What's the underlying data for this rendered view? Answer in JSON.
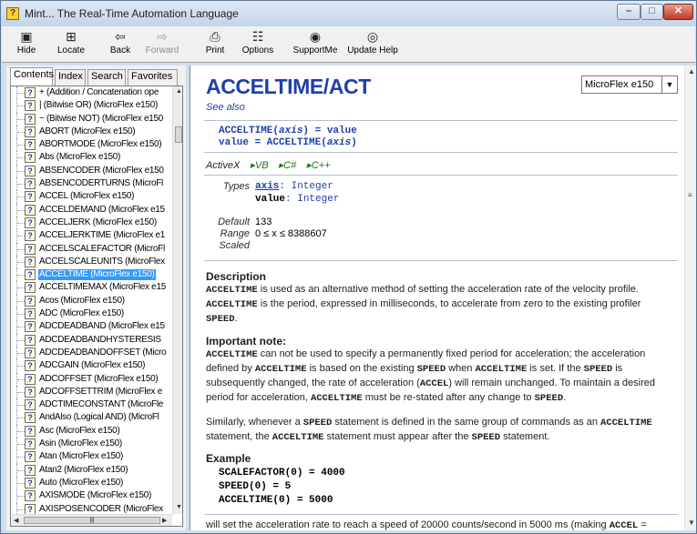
{
  "window": {
    "title": "Mint... The Real-Time Automation Language",
    "app_icon_glyph": "?",
    "min_glyph": "–",
    "max_glyph": "□",
    "close_glyph": "✕"
  },
  "toolbar": {
    "hide": {
      "label": "Hide",
      "icon": "hide-pane-icon",
      "glyph": "▣"
    },
    "locate": {
      "label": "Locate",
      "icon": "locate-icon",
      "glyph": "⊞"
    },
    "back": {
      "label": "Back",
      "icon": "back-arrow-icon",
      "glyph": "⇦"
    },
    "forward": {
      "label": "Forward",
      "icon": "forward-arrow-icon",
      "glyph": "⇨"
    },
    "print": {
      "label": "Print",
      "icon": "printer-icon",
      "glyph": "⎙"
    },
    "options": {
      "label": "Options",
      "icon": "options-icon",
      "glyph": "☷"
    },
    "supportme": {
      "label": "SupportMe",
      "icon": "supportme-icon",
      "glyph": "◉"
    },
    "update_help": {
      "label": "Update Help",
      "icon": "globe-icon",
      "glyph": "◎"
    }
  },
  "tabs": [
    "Contents",
    "Index",
    "Search",
    "Favorites"
  ],
  "tree": {
    "items": [
      "+ (Addition / Concatenation ope",
      "| (Bitwise OR) (MicroFlex e150)",
      "~ (Bitwise NOT) (MicroFlex e150",
      "ABORT (MicroFlex e150)",
      "ABORTMODE (MicroFlex e150)",
      "Abs (MicroFlex e150)",
      "ABSENCODER (MicroFlex e150",
      "ABSENCODERTURNS (MicroFl",
      "ACCEL (MicroFlex e150)",
      "ACCELDEMAND (MicroFlex e15",
      "ACCELJERK (MicroFlex e150)",
      "ACCELJERKTIME (MicroFlex e1",
      "ACCELSCALEFACTOR (MicroFl",
      "ACCELSCALEUNITS (MicroFlex",
      "ACCELTIME (MicroFlex e150)",
      "ACCELTIMEMAX (MicroFlex e15",
      "Acos (MicroFlex e150)",
      "ADC (MicroFlex e150)",
      "ADCDEADBAND (MicroFlex e15",
      "ADCDEADBANDHYSTERESIS",
      "ADCDEADBANDOFFSET (Micro",
      "ADCGAIN (MicroFlex e150)",
      "ADCOFFSET (MicroFlex e150)",
      "ADCOFFSETTRIM (MicroFlex e",
      "ADCTIMECONSTANT (MicroFle",
      "AndAlso (Logical AND) (MicroFl",
      "Asc (MicroFlex e150)",
      "Asin (MicroFlex e150)",
      "Atan (MicroFlex e150)",
      "Atan2 (MicroFlex e150)",
      "Auto (MicroFlex e150)",
      "AXISMODE (MicroFlex e150)",
      "AXISPOSENCODER (MicroFlex"
    ],
    "selected_index": 14,
    "item_icon": "help-topic-icon"
  },
  "topic": {
    "heading": "ACCELTIME/ACT",
    "see_also": "See also",
    "product_select": "MicroFlex e150",
    "syntax_line1_a": "ACCELTIME(",
    "syntax_line1_arg": "axis",
    "syntax_line1_b": ") = value",
    "syntax_line2_a": "value = ACCELTIME(",
    "syntax_line2_arg": "axis",
    "syntax_line2_b": ")",
    "activex_label": "ActiveX",
    "activex_links": [
      "VB",
      "C#",
      "C++"
    ],
    "types_label": "Types",
    "type_axis_name": "axis",
    "type_axis_type": ": Integer",
    "type_value_name": "value",
    "type_value_type": ": Integer",
    "default_label": "Default",
    "default_value": "133",
    "range_label": "Range",
    "range_value": "0 ≤ x ≤ 8388607",
    "scaled_label": "Scaled",
    "description_title": "Description",
    "desc_1_kw": "ACCELTIME",
    "desc_1_text": " is used as an alternative method of setting the acceleration rate of the velocity profile.",
    "desc_2_kw": "ACCELTIME",
    "desc_2_text": " is the period, expressed in milliseconds, to accelerate from zero to the existing profiler",
    "desc_3_kw": "SPEED",
    "desc_3_text": ".",
    "note_title": "Important note:",
    "note_l1_kw": "ACCELTIME",
    "note_l1_text": " can not be used to specify a permanently fixed period for acceleration; the acceleration",
    "note_l2_a": "defined by ",
    "note_l2_kw1": "ACCELTIME",
    "note_l2_b": " is based on the existing ",
    "note_l2_kw2": "SPEED",
    "note_l2_c": " when ",
    "note_l2_kw3": "ACCELTIME",
    "note_l2_d": " is set. If the ",
    "note_l2_kw4": "SPEED",
    "note_l2_e": " is",
    "note_l3_a": "subsequently changed, the rate of acceleration (",
    "note_l3_kw": "ACCEL",
    "note_l3_b": ") will remain unchanged. To maintain a desired",
    "note_l4_a": "period for acceleration, ",
    "note_l4_kw1": "ACCELTIME",
    "note_l4_b": " must be re-stated after any change to ",
    "note_l4_kw2": "SPEED",
    "note_l4_c": ".",
    "sim_l1_a": "Similarly, whenever a ",
    "sim_l1_kw1": "SPEED",
    "sim_l1_b": " statement is defined in the same group of commands as an ",
    "sim_l1_kw2": "ACCELTIME",
    "sim_l2_a": "statement, the ",
    "sim_l2_kw1": "ACCELTIME",
    "sim_l2_b": " statement must appear after the ",
    "sim_l2_kw2": "SPEED",
    "sim_l2_c": " statement.",
    "example_title": "Example",
    "example_code": [
      "SCALEFACTOR(0) = 4000",
      "SPEED(0) = 5",
      "ACCELTIME(0) = 5000"
    ],
    "tail_a": "will set the acceleration rate to reach a speed of 20000 counts/second in 5000 ms (making ",
    "tail_kw": "ACCEL",
    "tail_b": " ="
  },
  "colors": {
    "heading_blue": "#1f3fa9",
    "link_green": "#1a7a1a",
    "selection": "#3399ff"
  }
}
